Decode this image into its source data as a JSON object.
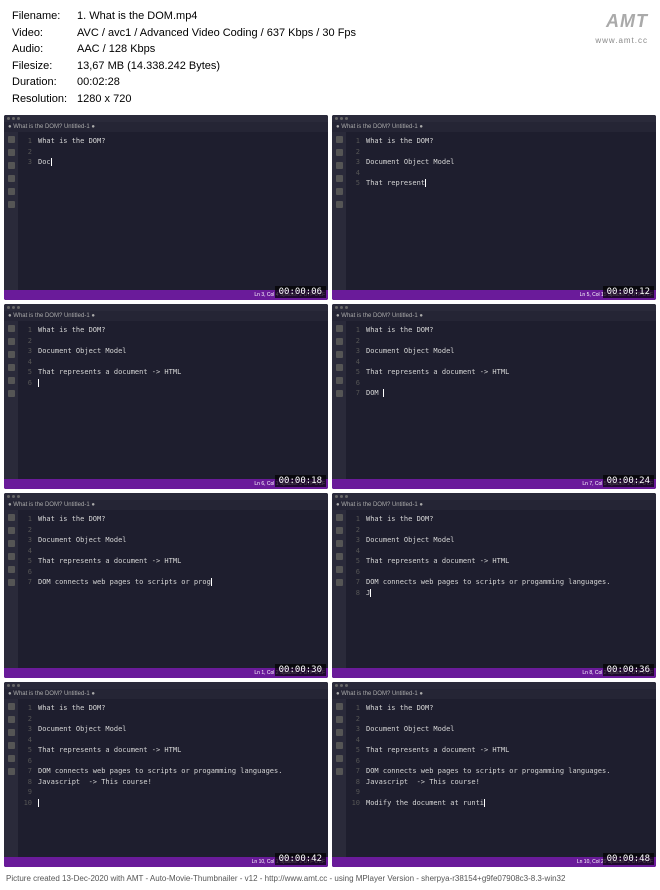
{
  "meta": {
    "filename_label": "Filename:",
    "filename": "1. What is the DOM.mp4",
    "video_label": "Video:",
    "video": "AVC / avc1 / Advanced Video Coding / 637 Kbps / 30 Fps",
    "audio_label": "Audio:",
    "audio": "AAC / 128 Kbps",
    "filesize_label": "Filesize:",
    "filesize": "13,67 MB (14.338.242 Bytes)",
    "duration_label": "Duration:",
    "duration": "00:02:28",
    "resolution_label": "Resolution:",
    "resolution": "1280 x 720"
  },
  "logo": {
    "text": "AMT",
    "url": "www.amt.cc"
  },
  "thumbs": [
    {
      "tab": "● What is the DOM?  Untitled-1  ●",
      "lines": [
        {
          "n": "1",
          "t": "What is the DOM?"
        },
        {
          "n": "2",
          "t": ""
        },
        {
          "n": "3",
          "t": "Doc",
          "cursor": true
        }
      ],
      "status": "Ln 3, Col 4   Spaces: 2   UTF-8   LF",
      "ts": "00:00:06"
    },
    {
      "tab": "● What is the DOM?  Untitled-1  ●",
      "lines": [
        {
          "n": "1",
          "t": "What is the DOM?"
        },
        {
          "n": "2",
          "t": ""
        },
        {
          "n": "3",
          "t": "Document Object Model"
        },
        {
          "n": "4",
          "t": ""
        },
        {
          "n": "5",
          "t": "That represent",
          "cursor": true
        }
      ],
      "status": "Ln 5, Col 15   Spaces: 2   UTF-8   LF",
      "ts": "00:00:12"
    },
    {
      "tab": "● What is the DOM?  Untitled-1  ●",
      "lines": [
        {
          "n": "1",
          "t": "What is the DOM?"
        },
        {
          "n": "2",
          "t": ""
        },
        {
          "n": "3",
          "t": "Document Object Model"
        },
        {
          "n": "4",
          "t": ""
        },
        {
          "n": "5",
          "t": "That represents a document -> HTML"
        },
        {
          "n": "6",
          "t": "",
          "cursor": true
        }
      ],
      "status": "Ln 6, Col 1   Spaces: 2   UTF-8   LF",
      "ts": "00:00:18"
    },
    {
      "tab": "● What is the DOM?  Untitled-1  ●",
      "lines": [
        {
          "n": "1",
          "t": "What is the DOM?"
        },
        {
          "n": "2",
          "t": ""
        },
        {
          "n": "3",
          "t": "Document Object Model"
        },
        {
          "n": "4",
          "t": ""
        },
        {
          "n": "5",
          "t": "That represents a document -> HTML"
        },
        {
          "n": "6",
          "t": ""
        },
        {
          "n": "7",
          "t": "DOM ",
          "cursor": true
        }
      ],
      "status": "Ln 7, Col 5   Spaces: 2   UTF-8   LF",
      "ts": "00:00:24"
    },
    {
      "tab": "● What is the DOM?  Untitled-1  ●",
      "lines": [
        {
          "n": "1",
          "t": "What is the DOM?"
        },
        {
          "n": "2",
          "t": ""
        },
        {
          "n": "3",
          "t": "Document Object Model"
        },
        {
          "n": "4",
          "t": ""
        },
        {
          "n": "5",
          "t": "That represents a document -> HTML"
        },
        {
          "n": "6",
          "t": ""
        },
        {
          "n": "7",
          "t": "DOM connects web pages to scripts or prog",
          "cursor": true
        }
      ],
      "status": "Ln 1, Col 2   Spaces: 2   UTF-8   LF",
      "ts": "00:00:30"
    },
    {
      "tab": "● What is the DOM?  Untitled-1  ●",
      "lines": [
        {
          "n": "1",
          "t": "What is the DOM?"
        },
        {
          "n": "2",
          "t": ""
        },
        {
          "n": "3",
          "t": "Document Object Model"
        },
        {
          "n": "4",
          "t": ""
        },
        {
          "n": "5",
          "t": "That represents a document -> HTML"
        },
        {
          "n": "6",
          "t": ""
        },
        {
          "n": "7",
          "t": "DOM connects web pages to scripts or progamming languages."
        },
        {
          "n": "8",
          "t": "J",
          "cursor": true
        }
      ],
      "status": "Ln 8, Col 2   Spaces: 2   UTF-8   LF",
      "ts": "00:00:36"
    },
    {
      "tab": "● What is the DOM?  Untitled-1  ●",
      "lines": [
        {
          "n": "1",
          "t": "What is the DOM?"
        },
        {
          "n": "2",
          "t": ""
        },
        {
          "n": "3",
          "t": "Document Object Model"
        },
        {
          "n": "4",
          "t": ""
        },
        {
          "n": "5",
          "t": "That represents a document -> HTML"
        },
        {
          "n": "6",
          "t": ""
        },
        {
          "n": "7",
          "t": "DOM connects web pages to scripts or progamming languages."
        },
        {
          "n": "8",
          "t": "Javascript  -> This course!"
        },
        {
          "n": "9",
          "t": ""
        },
        {
          "n": "10",
          "t": "",
          "cursor": true
        }
      ],
      "status": "Ln 10, Col 1   Spaces: 2   UTF-8   LF",
      "ts": "00:00:42"
    },
    {
      "tab": "● What is the DOM?  Untitled-1  ●",
      "lines": [
        {
          "n": "1",
          "t": "What is the DOM?"
        },
        {
          "n": "2",
          "t": ""
        },
        {
          "n": "3",
          "t": "Document Object Model"
        },
        {
          "n": "4",
          "t": ""
        },
        {
          "n": "5",
          "t": "That represents a document -> HTML"
        },
        {
          "n": "6",
          "t": ""
        },
        {
          "n": "7",
          "t": "DOM connects web pages to scripts or progamming languages."
        },
        {
          "n": "8",
          "t": "Javascript  -> This course!"
        },
        {
          "n": "9",
          "t": ""
        },
        {
          "n": "10",
          "t": "Modify the document at runti",
          "cursor": true
        }
      ],
      "status": "Ln 10, Col 29   Spaces: 2   UTF-8   LF",
      "ts": "00:00:48"
    }
  ],
  "footer": "Picture created 13-Dec-2020 with AMT - Auto-Movie-Thumbnailer - v12 - http://www.amt.cc - using MPlayer Version - sherpya-r38154+g9fe07908c3-8.3-win32"
}
